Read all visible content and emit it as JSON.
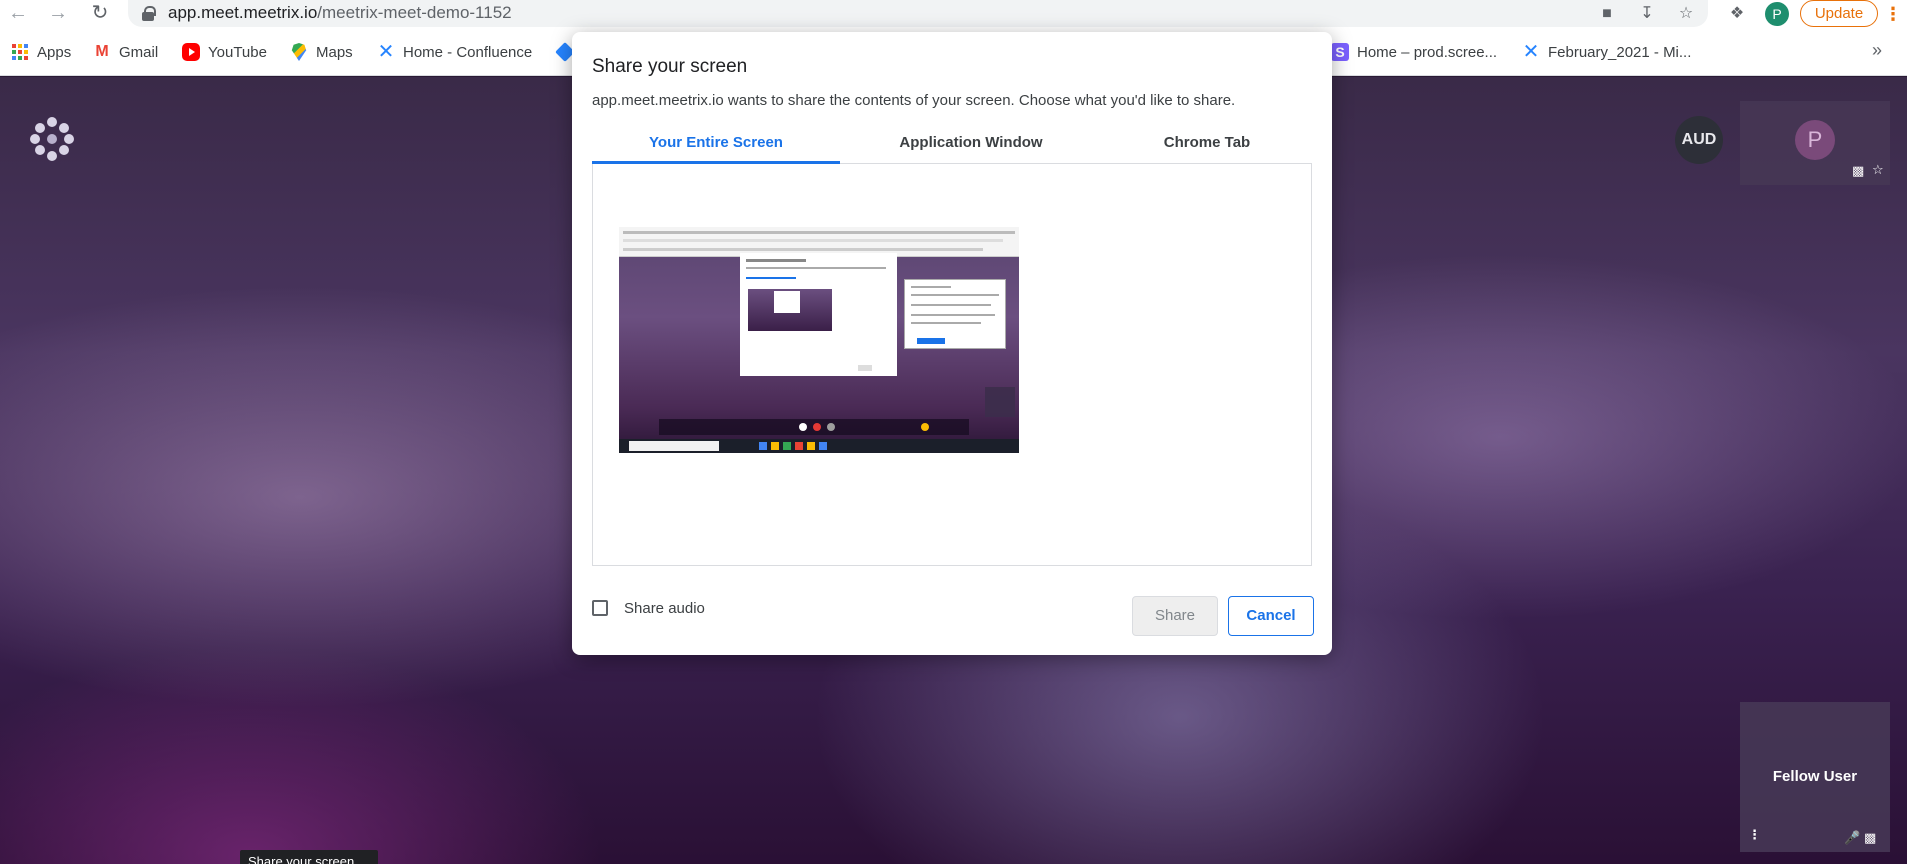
{
  "browser": {
    "url_host": "app.meet.meetrix.io",
    "url_path": "/meetrix-meet-demo-1152",
    "profile_initial": "P",
    "update_label": "Update",
    "icons": [
      "back-icon",
      "forward-icon",
      "reload-icon",
      "lock-icon",
      "camera-icon",
      "install-icon",
      "star-icon",
      "extensions-icon",
      "menu-icon"
    ]
  },
  "bookmarks": [
    {
      "label": "Apps",
      "icon": "apps-icon"
    },
    {
      "label": "Gmail",
      "icon": "gmail-icon"
    },
    {
      "label": "YouTube",
      "icon": "youtube-icon"
    },
    {
      "label": "Maps",
      "icon": "maps-icon"
    },
    {
      "label": "Home - Confluence",
      "icon": "confluence-icon"
    },
    {
      "label": "Home – prod.scree...",
      "icon": "screen-icon"
    },
    {
      "label": "February_2021 - Mi...",
      "icon": "confluence-icon"
    }
  ],
  "meeting": {
    "aud_badge": "AUD",
    "participant_initial": "P",
    "fellow_user_label": "Fellow User",
    "tooltip": "Share your screen"
  },
  "dialog": {
    "title": "Share your screen",
    "description": "app.meet.meetrix.io wants to share the contents of your screen. Choose what you'd like to share.",
    "tabs": [
      {
        "label": "Your Entire Screen",
        "active": true
      },
      {
        "label": "Application Window",
        "active": false
      },
      {
        "label": "Chrome Tab",
        "active": false
      }
    ],
    "share_audio_label": "Share audio",
    "share_audio_checked": false,
    "share_button": "Share",
    "cancel_button": "Cancel"
  },
  "colors": {
    "accent": "#1a73e8",
    "update": "#e8710a",
    "profile": "#1e8e6e"
  }
}
